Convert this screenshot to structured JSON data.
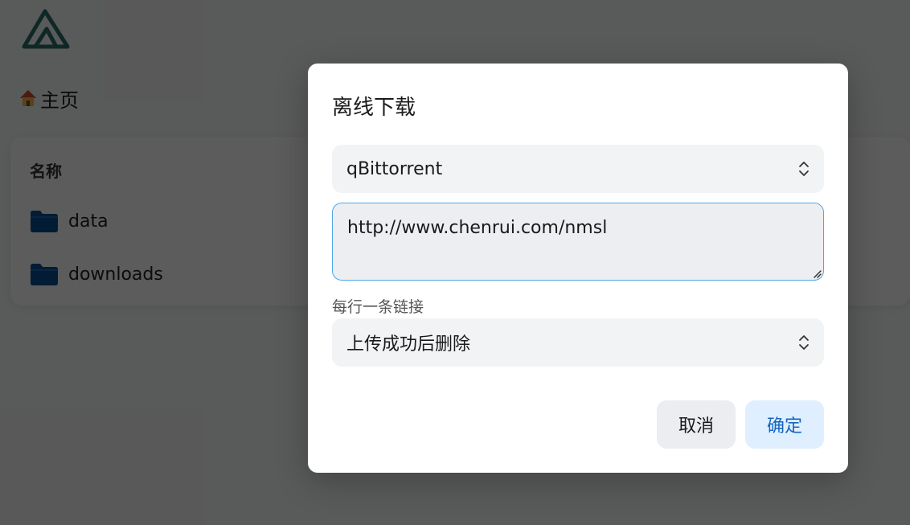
{
  "breadcrumb": {
    "home_label": "主页"
  },
  "file_list": {
    "column_name": "名称",
    "items": [
      {
        "name": "data"
      },
      {
        "name": "downloads"
      }
    ]
  },
  "dialog": {
    "title": "离线下载",
    "tool_select": {
      "value": "qBittorrent"
    },
    "urls_input": {
      "value": "http://www.chenrui.com/nmsl"
    },
    "urls_helper": "每行一条链接",
    "delete_policy_select": {
      "value": "上传成功后删除"
    },
    "cancel_label": "取消",
    "ok_label": "确定"
  },
  "colors": {
    "overlay": "#000000a3",
    "accent": "#1565c0",
    "folder": "#0b4f93",
    "logo": "#2a6f6a"
  }
}
